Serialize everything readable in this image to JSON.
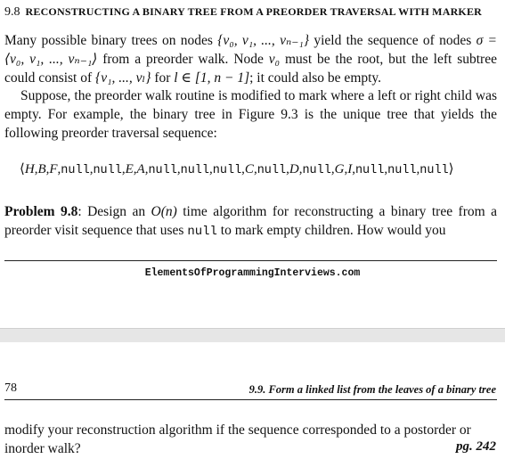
{
  "page1": {
    "section_number": "9.8",
    "section_title": "Reconstructing a binary tree from a preorder traversal with marker",
    "para1_a": "Many possible binary trees on nodes ",
    "nodes_set": "{v₀, v₁, ..., vₙ₋₁}",
    "para1_b": " yield the sequence of nodes ",
    "sigma_expr": "σ = ⟨v₀, v₁, ..., vₙ₋₁⟩",
    "para1_c": " from a preorder walk. Node ",
    "v0": "v₀",
    "para1_d": " must be the root, but the left subtree could consist of ",
    "subset": "{v₁, ..., vₗ}",
    "para1_e": " for ",
    "range_expr": "l ∈ [1, n − 1]",
    "para1_f": "; it could also be empty.",
    "para2": "Suppose, the preorder walk routine is modified to mark where a left or right child was empty. For example, the binary tree in Figure 9.3 is the unique tree that yields the following preorder traversal sequence:",
    "sequence_tokens": [
      "⟨",
      "H",
      ",",
      "B",
      ",",
      "F",
      ",",
      "null",
      ",",
      "null",
      ",",
      "E",
      ",",
      "A",
      ",",
      "null",
      ",",
      "null",
      ",",
      "null",
      ",",
      "C",
      ",",
      "null",
      ",",
      "D",
      ",",
      "null",
      ",",
      "G",
      ",",
      "I",
      ",",
      "null",
      ",",
      "null",
      ",",
      "null",
      "⟩"
    ],
    "problem_label": "Problem 9.8",
    "problem_text_a": ": Design an ",
    "complexity": "O(n)",
    "problem_text_b": " time algorithm for reconstructing a binary tree from a preorder visit sequence that uses ",
    "null_word": "null",
    "problem_text_c": " to mark empty children. How would you",
    "footer": "ElementsOfProgrammingInterviews.com"
  },
  "page2": {
    "page_number": "78",
    "running_head": "9.9. Form a linked list from the leaves of a binary tree",
    "continued_text": "modify your reconstruction algorithm if the sequence corresponded to a postorder or inorder walk?",
    "page_ref": "pg. 242"
  }
}
